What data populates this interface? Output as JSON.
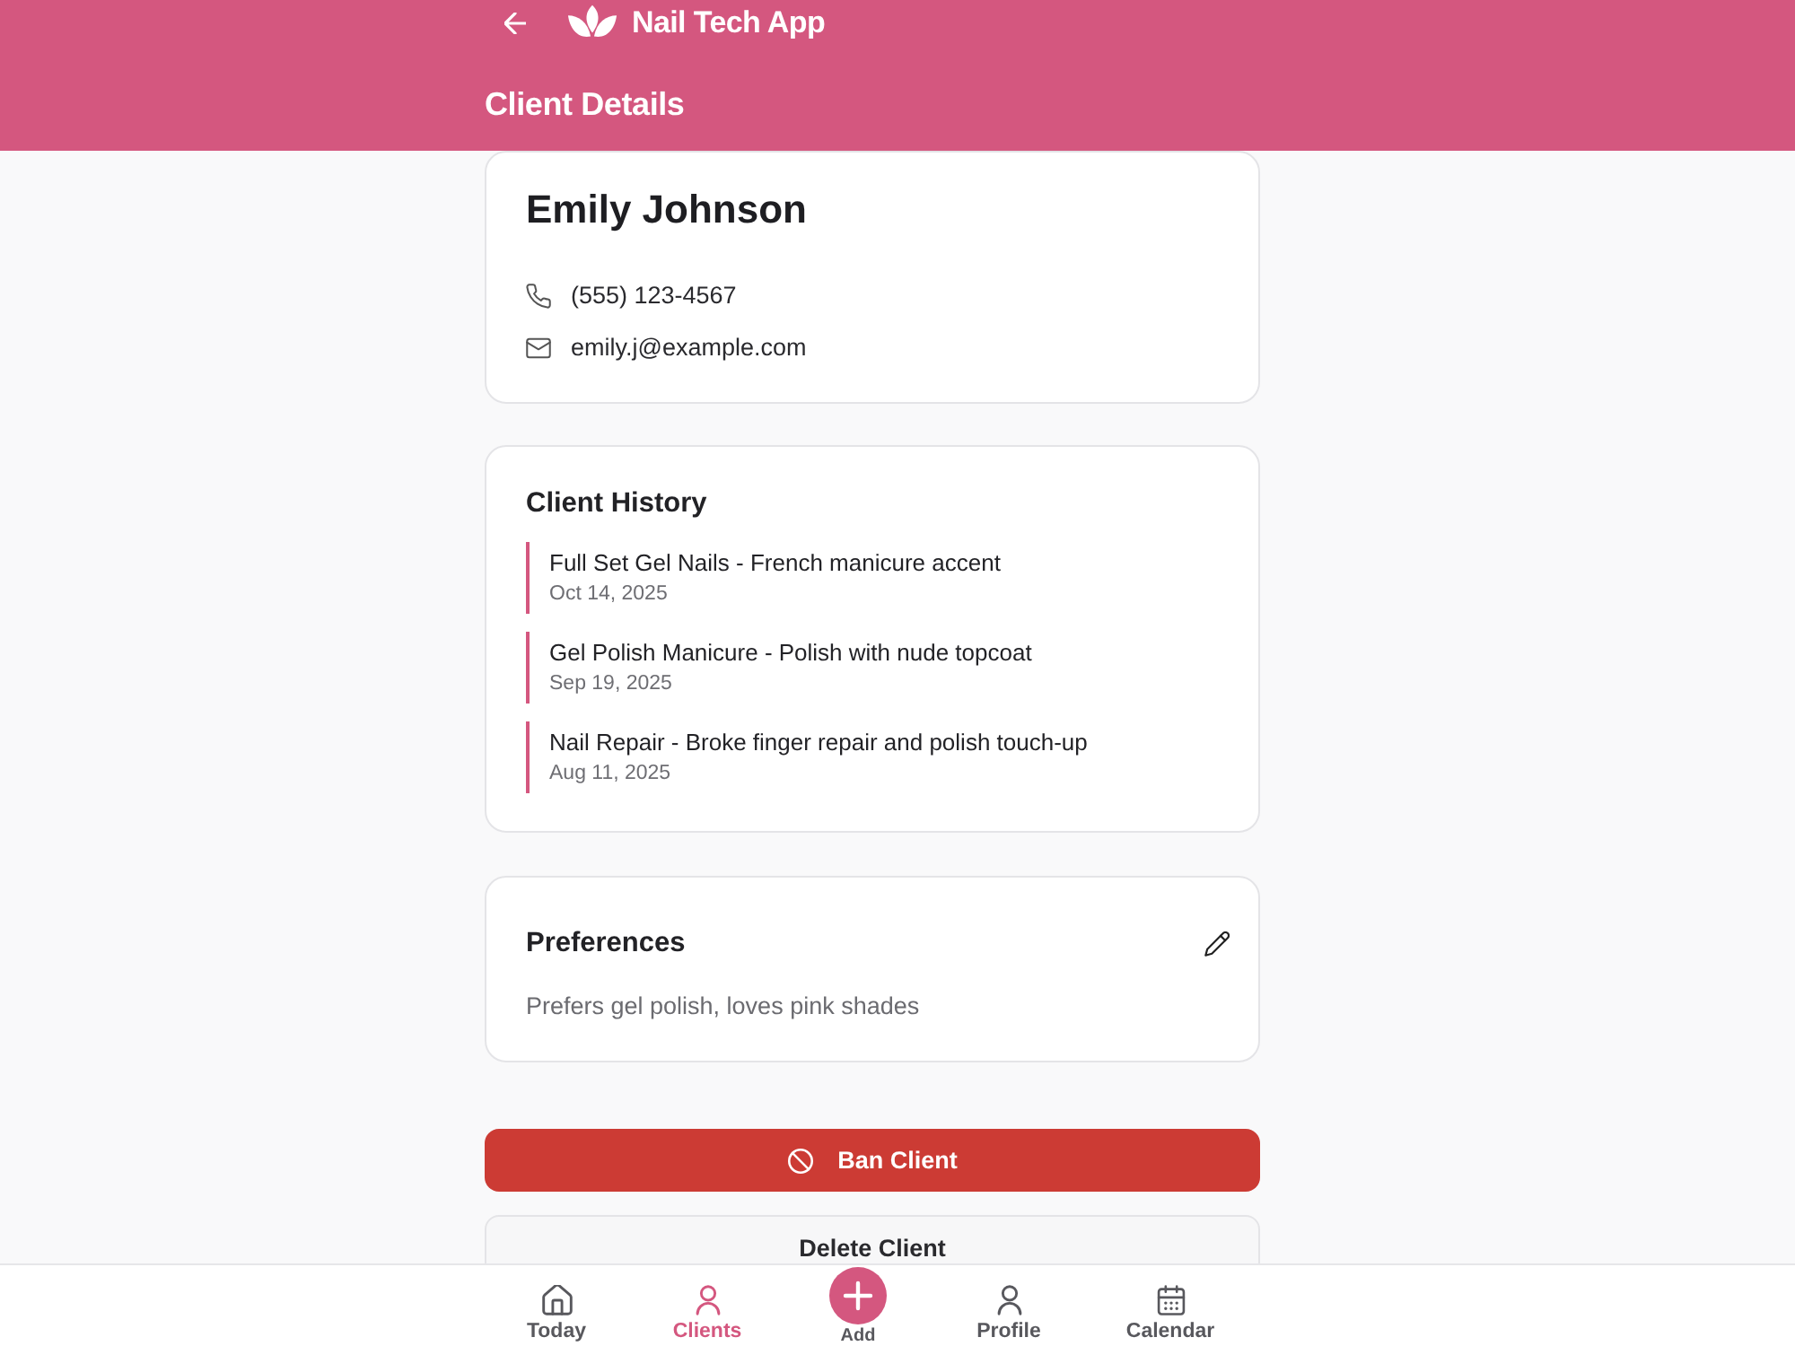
{
  "app": {
    "title": "Nail Tech App"
  },
  "page": {
    "title": "Client Details"
  },
  "client": {
    "name": "Emily Johnson",
    "contacts": [
      {
        "value": "(555) 123-4567"
      },
      {
        "value": "emily.j@example.com"
      }
    ]
  },
  "history": {
    "title": "Client History",
    "entries": [
      {
        "service": "Full Set Gel Nails - French manicure accent",
        "date": "Oct 14, 2025"
      },
      {
        "service": "Gel Polish Manicure - Polish with nude topcoat",
        "date": "Sep 19, 2025"
      },
      {
        "service": "Nail Repair - Broke finger repair and polish touch-up",
        "date": "Aug 11, 2025"
      }
    ]
  },
  "preferences": {
    "title": "Preferences",
    "text": "Prefers gel polish, loves pink shades"
  },
  "actions": [
    {
      "kind": "danger",
      "label": "Ban Client"
    },
    {
      "kind": "secondary",
      "label": "Delete Client"
    }
  ],
  "nav": [
    {
      "kind": "tab",
      "label": "Today",
      "selected": false
    },
    {
      "kind": "tab",
      "label": "Clients",
      "selected": true
    },
    {
      "kind": "add",
      "label": "Add",
      "selected": false
    },
    {
      "kind": "tab",
      "label": "Profile",
      "selected": false
    },
    {
      "kind": "tab",
      "label": "Calendar",
      "selected": false
    }
  ]
}
